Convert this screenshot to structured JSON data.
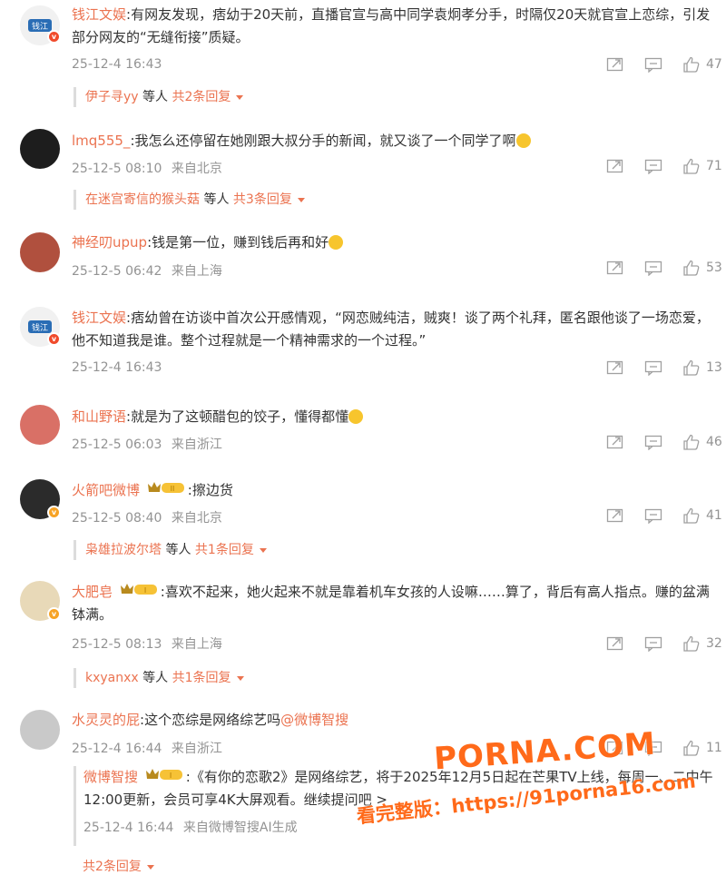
{
  "comments": [
    {
      "name": "钱江文娱",
      "text": ":有网友发现，痞幼于20天前，直播官宣与高中同学袁炯孝分手，时隔仅20天就官宣上恋综，引发部分网友的“无缝衔接”质疑。",
      "time": "25-12-4 16:43",
      "location": "",
      "likes": "47",
      "replies": {
        "names": "伊子寻yy",
        "sep": " 等人 ",
        "count": "共2条回复"
      }
    },
    {
      "name": "lmq555_",
      "text": ":我怎么还停留在她刚跟大叔分手的新闻，就又谈了一个同学了啊",
      "time": "25-12-5 08:10",
      "location": "来自北京",
      "likes": "71",
      "replies": {
        "names": "在迷宫寄信的猴头菇",
        "sep": " 等人 ",
        "count": "共3条回复"
      }
    },
    {
      "name": "神经叨upup",
      "text": ":钱是第一位，赚到钱后再和好",
      "time": "25-12-5 06:42",
      "location": "来自上海",
      "likes": "53"
    },
    {
      "name": "钱江文娱",
      "text": ":痞幼曾在访谈中首次公开感情观，“网恋贼纯洁，贼爽！谈了两个礼拜，匿名跟他谈了一场恋爱，他不知道我是谁。整个过程就是一个精神需求的一个过程。”",
      "time": "25-12-4 16:43",
      "location": "",
      "likes": "13"
    },
    {
      "name": "和山野语",
      "text": ":就是为了这顿醋包的饺子，懂得都懂",
      "time": "25-12-5 06:03",
      "location": "来自浙江",
      "likes": "46"
    },
    {
      "name": "火箭吧微博",
      "badge": "II",
      "text": ":擦边货",
      "time": "25-12-5 08:40",
      "location": "来自北京",
      "likes": "41",
      "replies": {
        "names": "枭雄拉波尔塔",
        "sep": " 等人 ",
        "count": "共1条回复"
      }
    },
    {
      "name": "大肥皂",
      "badge": "I",
      "text": ":喜欢不起来，她火起来不就是靠着机车女孩的人设嘛……算了，背后有高人指点。赚的盆满钵满。",
      "time": "25-12-5 08:13",
      "location": "来自上海",
      "likes": "32",
      "replies": {
        "names": "kxyanxx",
        "sep": " 等人 ",
        "count": "共1条回复"
      }
    },
    {
      "name": "水灵灵的屁",
      "text": ":这个恋综是网络综艺吗",
      "mention": "@微博智搜",
      "time": "25-12-4 16:44",
      "location": "来自浙江",
      "likes": "11"
    }
  ],
  "subreply": {
    "name": "微博智搜",
    "badge": "I",
    "text": ":《有你的恋歌2》是网络综艺，将于2025年12月5日起在芒果TV上线，每周一、二中午12:00更新，会员可享4K大屏观看。继续提问吧 >",
    "time": "25-12-4 16:44",
    "location": "来自微博智搜AI生成",
    "more": "共2条回复"
  },
  "watermark": {
    "line1": "PORNA.COM",
    "line2": "看完整版：https://91porna16.com"
  },
  "colors": {
    "accent": "#eb7350",
    "meta": "#939393",
    "text": "#333333"
  },
  "icons": [
    "share-icon",
    "comment-icon",
    "like-icon",
    "chevron-down-icon",
    "crown-badge-icon"
  ]
}
